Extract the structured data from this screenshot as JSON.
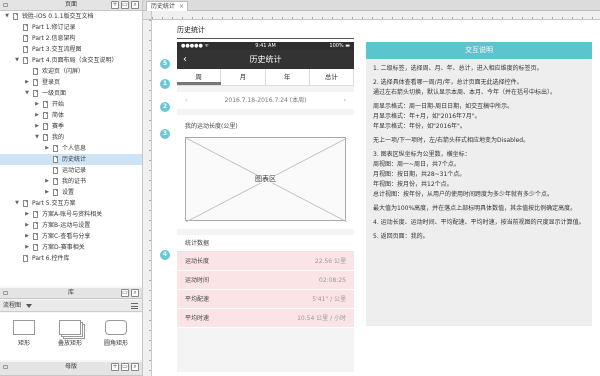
{
  "left_panel": {
    "pages_title": "页面",
    "pages": [
      {
        "label": "锐胜-iOS 0.1.1版交互文档",
        "level": 0,
        "arrow": "down",
        "selected": false
      },
      {
        "label": "Part 1.修订记录",
        "level": 1,
        "arrow": "",
        "selected": false
      },
      {
        "label": "Part 2.信息架构",
        "level": 1,
        "arrow": "",
        "selected": false
      },
      {
        "label": "Part 3.交互流程图",
        "level": 1,
        "arrow": "",
        "selected": false
      },
      {
        "label": "Part 4.页面布局（含交互说明）",
        "level": 1,
        "arrow": "down",
        "selected": false
      },
      {
        "label": "欢迎页（闪屏）",
        "level": 2,
        "arrow": "",
        "selected": false
      },
      {
        "label": "登录页",
        "level": 2,
        "arrow": "right",
        "selected": false
      },
      {
        "label": "一级页面",
        "level": 2,
        "arrow": "down",
        "selected": false
      },
      {
        "label": "开始",
        "level": 3,
        "arrow": "right",
        "selected": false
      },
      {
        "label": "简体",
        "level": 3,
        "arrow": "right",
        "selected": false
      },
      {
        "label": "赛季",
        "level": 3,
        "arrow": "right",
        "selected": false
      },
      {
        "label": "我的",
        "level": 3,
        "arrow": "down",
        "selected": false
      },
      {
        "label": "个人信息",
        "level": 4,
        "arrow": "right",
        "selected": false
      },
      {
        "label": "历史统计",
        "level": 4,
        "arrow": "",
        "selected": true
      },
      {
        "label": "运动记录",
        "level": 4,
        "arrow": "",
        "selected": false
      },
      {
        "label": "我的证书",
        "level": 4,
        "arrow": "right",
        "selected": false
      },
      {
        "label": "设置",
        "level": 4,
        "arrow": "right",
        "selected": false
      },
      {
        "label": "Part 5.交互方案",
        "level": 1,
        "arrow": "down",
        "selected": false
      },
      {
        "label": "方案A-账号与资料相关",
        "level": 2,
        "arrow": "right",
        "selected": false
      },
      {
        "label": "方案B-运动与设置",
        "level": 2,
        "arrow": "right",
        "selected": false
      },
      {
        "label": "方案C-查看与分享",
        "level": 2,
        "arrow": "right",
        "selected": false
      },
      {
        "label": "方案D-赛事相关",
        "level": 2,
        "arrow": "right",
        "selected": false
      },
      {
        "label": "Part 6.控件库",
        "level": 1,
        "arrow": "",
        "selected": false
      }
    ],
    "library_title": "库",
    "library_select": "流程图",
    "library_items": [
      {
        "label": "矩形",
        "shape": "rect"
      },
      {
        "label": "叠放矩形",
        "shape": "stack"
      },
      {
        "label": "圆角矩形",
        "shape": "round"
      }
    ],
    "masters_title": "母版"
  },
  "editor": {
    "tab_label": "历史统计",
    "tab_close": "×",
    "page_title": "历史统计"
  },
  "phone": {
    "status_left": "●●●●● ᯤ",
    "status_time": "9:41 AM",
    "status_right": "100% ▬",
    "nav_title": "历史统计",
    "nav_back": "‹",
    "tabs": [
      "周",
      "月",
      "年",
      "总计"
    ],
    "active_tab": 0,
    "date_left": "‹",
    "date_range": "2016.7.18-2016.7.24 (本周)",
    "date_right": "›",
    "chart_caption": "我的运动长度(公里)",
    "chart_placeholder": "图表区",
    "stats_title": "统计数据",
    "stats": [
      {
        "label": "运动长度",
        "value": "22.56 公里"
      },
      {
        "label": "运动时间",
        "value": "02:08:25"
      },
      {
        "label": "平均配速",
        "value": "5'41\" / 公里"
      },
      {
        "label": "平均时速",
        "value": "10.54 公里 / 小时"
      }
    ]
  },
  "markers": [
    "5",
    "1",
    "2",
    "3",
    "4"
  ],
  "notes": {
    "title": "交互说明",
    "paragraphs": [
      "1. 二级标签，选择周、月、年、总计，进入相应维度的标签页。",
      "2. 选择具体查看哪一周/月/年，总计页面无此选择控件。\n通过左右箭头切换，默认显示本周、本月、今年（并在括号中标出）。",
      "周显示格式：周一日期-周日日期，如交互稿中所示。\n月显示格式：年+月，如\"2016年7月\"。\n年显示格式：年份，如\"2016年\"。",
      "无上一项/下一项时，左/右箭头样式相应地变为Disabled。",
      "3. 图表区纵坐标为公里数，横坐标：\n周视图：周一~周日，共7个点。\n月视图：按日期，共28~31个点。\n年视图：按月份，共12个点。\n总计视图：按年份，从用户的使用时间跨度为多少年就有多少个点。",
      "最大值为100%高度，并在落点上部标明具体数值，其余值按比例确定高度。",
      "4. 运动长度、运动时间、平均配速、平均时速，按当前视图的尺度显示计算值。",
      "5. 返回页面：我的。"
    ]
  },
  "colors": {
    "accent": "#5bc4cd",
    "marker": "#6cc7d4",
    "nav_bg": "#333333",
    "stat_row_bg": "#fbe4e6",
    "tree_selected": "#cde4f7"
  }
}
